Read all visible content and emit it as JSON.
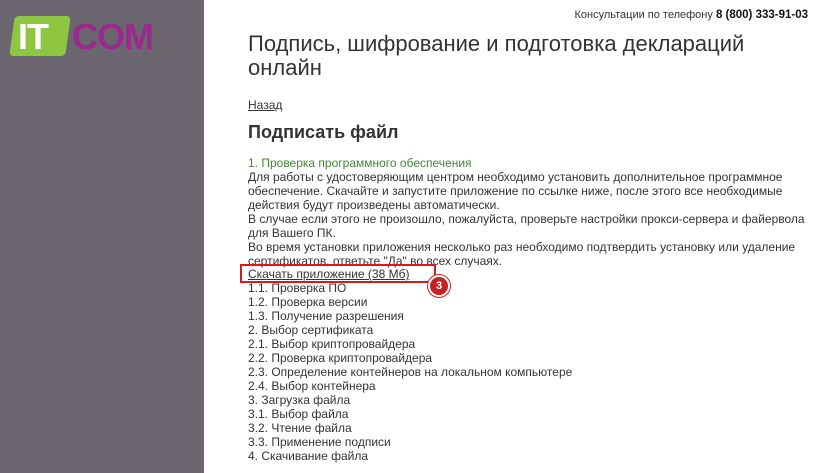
{
  "logo": {
    "part1": "IT",
    "part2": "COM"
  },
  "header": {
    "phone_label": "Консультации по телефону",
    "phone_number": "8 (800) 333-91-03"
  },
  "page": {
    "title": "Подпись, шифрование и подготовка деклараций онлайн",
    "back_link": "Назад",
    "heading": "Подписать файл"
  },
  "step1": {
    "label": "1. Проверка программного обеспечения",
    "para1": "Для работы с удостоверяющим центром необходимо установить дополнительное программное обеспечение. Скачайте и запустите приложение по ссылке ниже, после этого все необходимые действия будут произведены автоматически.",
    "para2": "В случае если этого не произошло, пожалуйста, проверьте настройки прокси-сервера и файервола для Вашего ПК.",
    "para3": "Во время установки приложения несколько раз необходимо подтвердить установку или удаление сертификатов, ответьте \"Да\" во всех случаях."
  },
  "download": {
    "label": "Скачать приложение (38 Мб)"
  },
  "annotation": {
    "number": "3",
    "color": "#c42323"
  },
  "steps": [
    "1.1. Проверка ПО",
    "1.2. Проверка версии",
    "1.3. Получение разрешения",
    "2. Выбор сертификата",
    "2.1. Выбор криптопровайдера",
    "2.2. Проверка криптопровайдера",
    "2.3. Определение контейнеров на локальном компьютере",
    "2.4. Выбор контейнера",
    "3. Загрузка файла",
    "3.1. Выбор файла",
    "3.2. Чтение файла",
    "3.3. Применение подписи",
    "4. Скачивание файла"
  ],
  "colors": {
    "sidebar": "#6b6570",
    "logo_green": "#8ec641",
    "logo_purple": "#9b2a8e",
    "step_green": "#3d8a2e",
    "highlight_red": "#cc2020"
  }
}
